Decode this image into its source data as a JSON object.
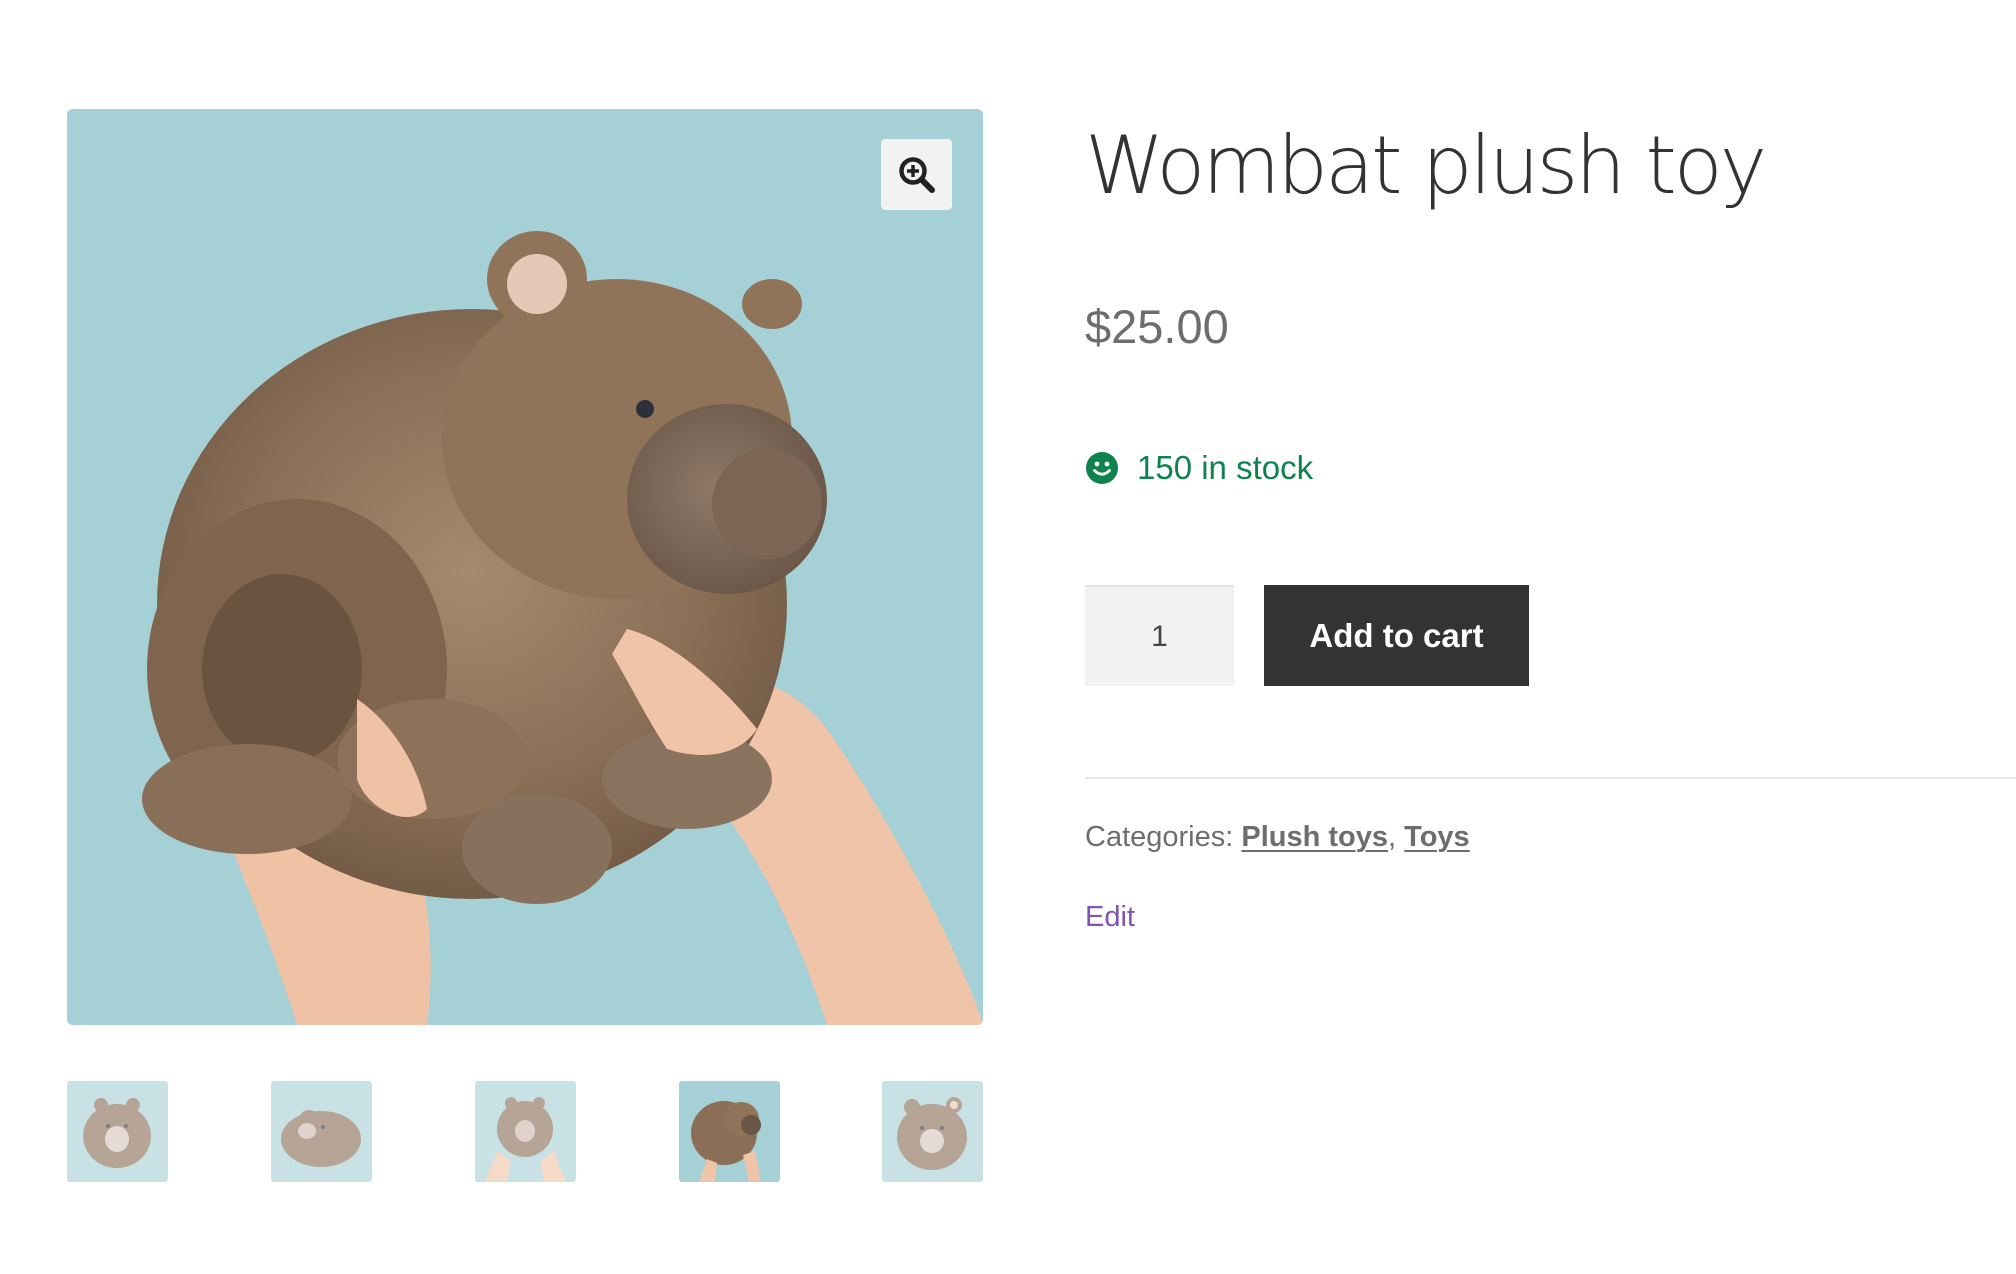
{
  "product": {
    "title": "Wombat plush toy",
    "price": "$25.00",
    "stock_text": "150 in stock",
    "quantity_value": "1",
    "add_to_cart_label": "Add to cart",
    "categories_label": "Categories:",
    "categories": [
      "Plush toys",
      "Toys"
    ],
    "category_separator": ",",
    "edit_label": "Edit"
  },
  "gallery": {
    "zoom_icon": "magnifier-plus-icon",
    "main_image": "wombat-plush-held-in-hands",
    "thumbnails": [
      {
        "image": "wombat-plush-front",
        "active": false
      },
      {
        "image": "wombat-plush-side",
        "active": false
      },
      {
        "image": "wombat-plush-held-front",
        "active": false
      },
      {
        "image": "wombat-plush-held-in-hands",
        "active": true
      },
      {
        "image": "wombat-plush-front-closeup",
        "active": false
      }
    ]
  },
  "colors": {
    "stock_green": "#0f834d",
    "button_dark": "#333333",
    "edit_link_purple": "#7f54b3",
    "photo_background": "#a5d0d6",
    "plush_brown": "#8d7157"
  }
}
